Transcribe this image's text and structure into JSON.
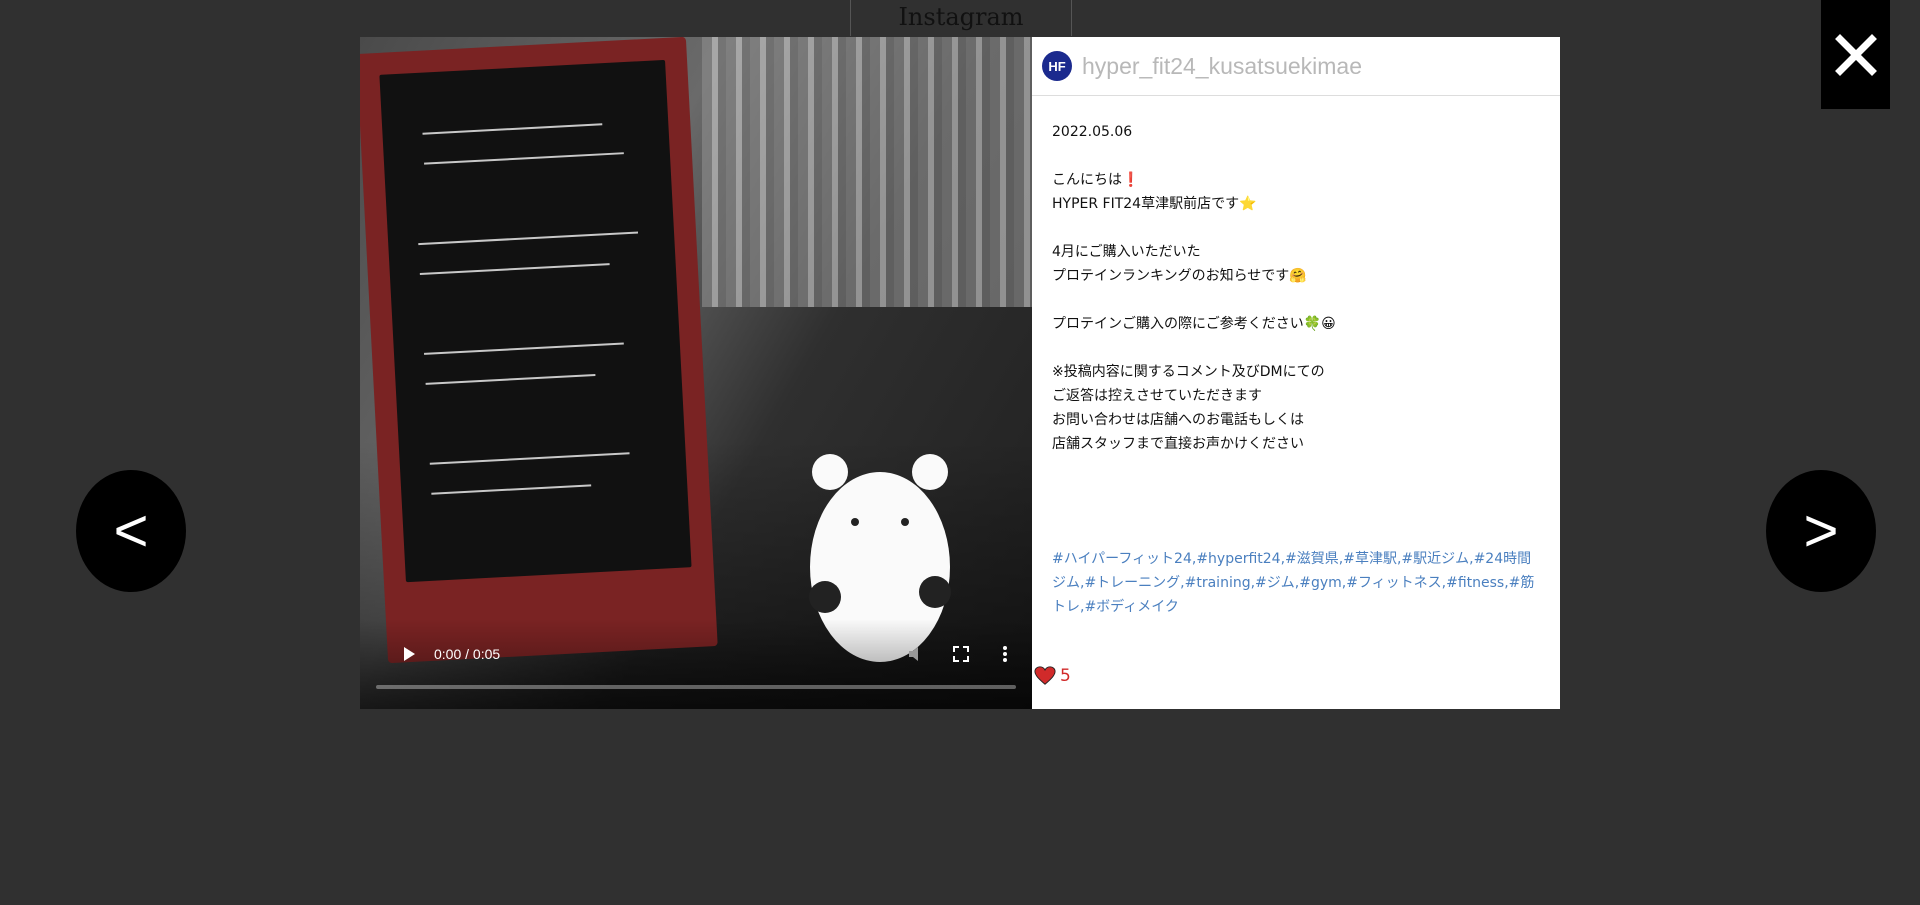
{
  "background_title": "Instagram",
  "close_icon": "close-icon",
  "nav": {
    "prev_label": "<",
    "next_label": ">"
  },
  "video": {
    "time": "0:00 / 0:05",
    "progress": 0,
    "controls": [
      "play-icon",
      "volume-icon",
      "fullscreen-icon",
      "more-icon"
    ]
  },
  "post": {
    "username": "hyper_fit24_kusatsuekimae",
    "avatar_text": "HF",
    "date": "2022.05.06",
    "lines": [
      "",
      "こんにちは❗",
      "HYPER FIT24草津駅前店です⭐",
      "",
      "4月にご購入いただいた",
      "プロテインランキングのお知らせです🤗",
      "",
      "プロテインご購入の際にご参考ください🍀😀",
      "",
      "※投稿内容に関するコメント及びDMにての",
      "ご返答は控えさせていただきます",
      "お問い合わせは店舗へのお電話もしくは",
      "店舗スタッフまで直接お声かけください"
    ],
    "hashtags": "#ハイパーフィット24,#hyperfit24,#滋賀県,#草津駅,#駅近ジム,#24時間ジム,#トレーニング,#training,#ジム,#gym,#フィットネス,#fitness,#筋トレ,#ボディメイク",
    "likes": "5",
    "heart_color": "#d12a2a",
    "hashtag_color": "#4a7fbf"
  }
}
